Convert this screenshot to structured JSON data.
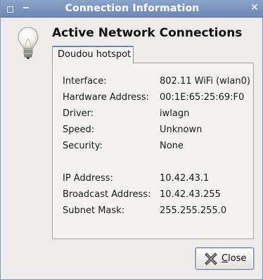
{
  "window": {
    "title": "Connection Information",
    "close_glyph": "✕"
  },
  "header": {
    "icon": "lightbulb-icon",
    "title": "Active Network Connections"
  },
  "tabs": [
    {
      "label": "Doudou hotspot",
      "selected": true
    }
  ],
  "details": {
    "interface": {
      "label": "Interface:",
      "value": "802.11 WiFi (wlan0)"
    },
    "hardware_address": {
      "label": "Hardware Address:",
      "value": "00:1E:65:25:69:F0"
    },
    "driver": {
      "label": "Driver:",
      "value": "iwlagn"
    },
    "speed": {
      "label": "Speed:",
      "value": "Unknown"
    },
    "security": {
      "label": "Security:",
      "value": "None"
    },
    "ip_address": {
      "label": "IP Address:",
      "value": "10.42.43.1"
    },
    "broadcast_address": {
      "label": "Broadcast Address:",
      "value": "10.42.43.255"
    },
    "subnet_mask": {
      "label": "Subnet Mask:",
      "value": "255.255.255.0"
    }
  },
  "footer": {
    "close_mnemonic": "C",
    "close_rest": "lose",
    "close_icon": "close-icon"
  },
  "colors": {
    "titlebar": "#7a94bd",
    "tab_accent": "#6a87b3",
    "background": "#edeceb"
  }
}
